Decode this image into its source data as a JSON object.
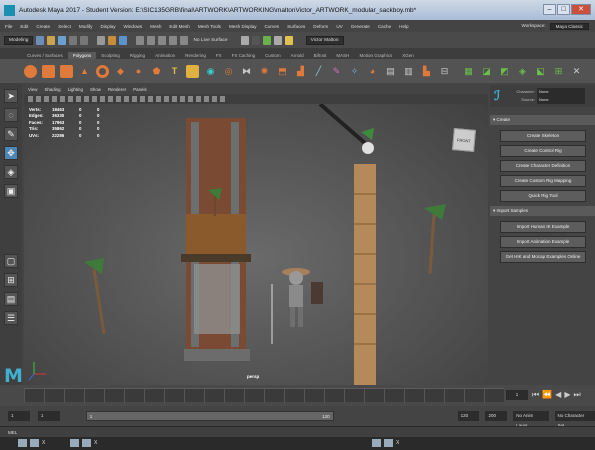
{
  "window": {
    "title": "Autodesk Maya 2017 - Student Version: E:\\SIC135GRB\\final\\ARTWORK\\ARTWORKING\\maltonVictor_ARTWORK_modular_sackboy.mb*",
    "min": "–",
    "max": "□",
    "close": "✕"
  },
  "menubar": {
    "items": [
      "File",
      "Edit",
      "Create",
      "Select",
      "Modify",
      "Display",
      "Windows",
      "Mesh",
      "Edit Mesh",
      "Mesh Tools",
      "Mesh Display",
      "Curves",
      "Surfaces",
      "Deform",
      "UV",
      "Generate",
      "Cache",
      "Help"
    ],
    "workspace_label": "Workspace:",
    "workspace_value": "Maya Classic"
  },
  "statusline": {
    "mode": "Modeling",
    "no_live_surface": "No Live Surface",
    "user": "Victor Malton"
  },
  "shelf": {
    "tabs": [
      "Curves / Surfaces",
      "Polygons",
      "Sculpting",
      "Rigging",
      "Animation",
      "Rendering",
      "FX",
      "FX Caching",
      "Custom",
      "Arnold",
      "Bifrost",
      "MASH",
      "Motion Graphics",
      "XGen"
    ],
    "active_tab": 1
  },
  "viewport": {
    "menu": [
      "View",
      "Shading",
      "Lighting",
      "Show",
      "Renderer",
      "Panels"
    ],
    "hud": [
      {
        "label": "Verts:",
        "v1": "18463",
        "v2": "0",
        "v3": "0"
      },
      {
        "label": "Edges:",
        "v1": "36330",
        "v2": "0",
        "v3": "0"
      },
      {
        "label": "Faces:",
        "v1": "17963",
        "v2": "0",
        "v3": "0"
      },
      {
        "label": "Tris:",
        "v1": "35862",
        "v2": "0",
        "v3": "0"
      },
      {
        "label": "UVs:",
        "v1": "22286",
        "v2": "0",
        "v3": "0"
      }
    ],
    "camera": "persp",
    "viewcube": "FRONT"
  },
  "hik": {
    "character_label": "Character:",
    "character_value": "None",
    "source_label": "Source:",
    "source_value": "None",
    "create_section": "Create",
    "create_buttons": [
      "Create Skeleton",
      "Create Control Rig",
      "Create Character Definition",
      "Create Custom Rig Mapping",
      "Quick Rig Tool"
    ],
    "import_section": "Import Samples",
    "import_buttons": [
      "Import Human IK Example",
      "Import Animation Example",
      "Get HIK and Mocap Examples Online"
    ]
  },
  "timeline": {
    "current_frame": "1"
  },
  "range": {
    "start": "1",
    "inner_start": "1",
    "bar_start": "1",
    "bar_end": "120",
    "end": "120",
    "anim_end": "200",
    "layer": "No Anim Layer",
    "char_set": "No Character Set"
  },
  "mel": {
    "label": "MEL"
  },
  "taskbar": {
    "close": "X"
  },
  "colors": {
    "accent": "#4c86b5",
    "maya_blue": "#3fb0d0"
  }
}
